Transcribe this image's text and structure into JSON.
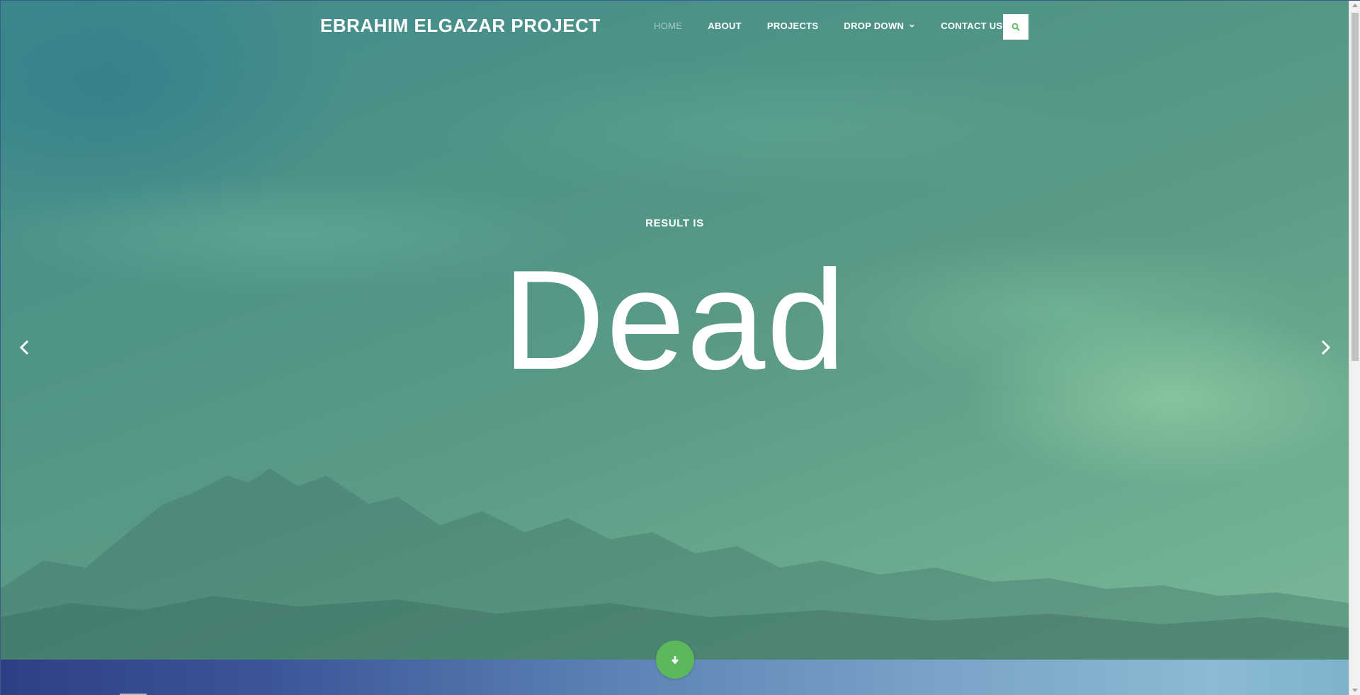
{
  "brand": {
    "title": "EBRAHIM ELGAZAR PROJECT"
  },
  "nav": {
    "items": [
      {
        "label": "HOME",
        "active": true
      },
      {
        "label": "ABOUT",
        "active": false
      },
      {
        "label": "PROJECTS",
        "active": false
      },
      {
        "label": "DROP DOWN",
        "active": false,
        "has_dropdown": true
      },
      {
        "label": "CONTACT US",
        "active": false
      }
    ],
    "search_icon": "search-icon"
  },
  "hero": {
    "subtitle": "RESULT IS",
    "headline": "Dead",
    "prev_icon": "chevron-left-icon",
    "next_icon": "chevron-right-icon",
    "scroll_icon": "arrow-down-icon"
  },
  "colors": {
    "accent": "#5cb85c",
    "nav_active": "#a8c8c4",
    "text": "#ffffff"
  }
}
